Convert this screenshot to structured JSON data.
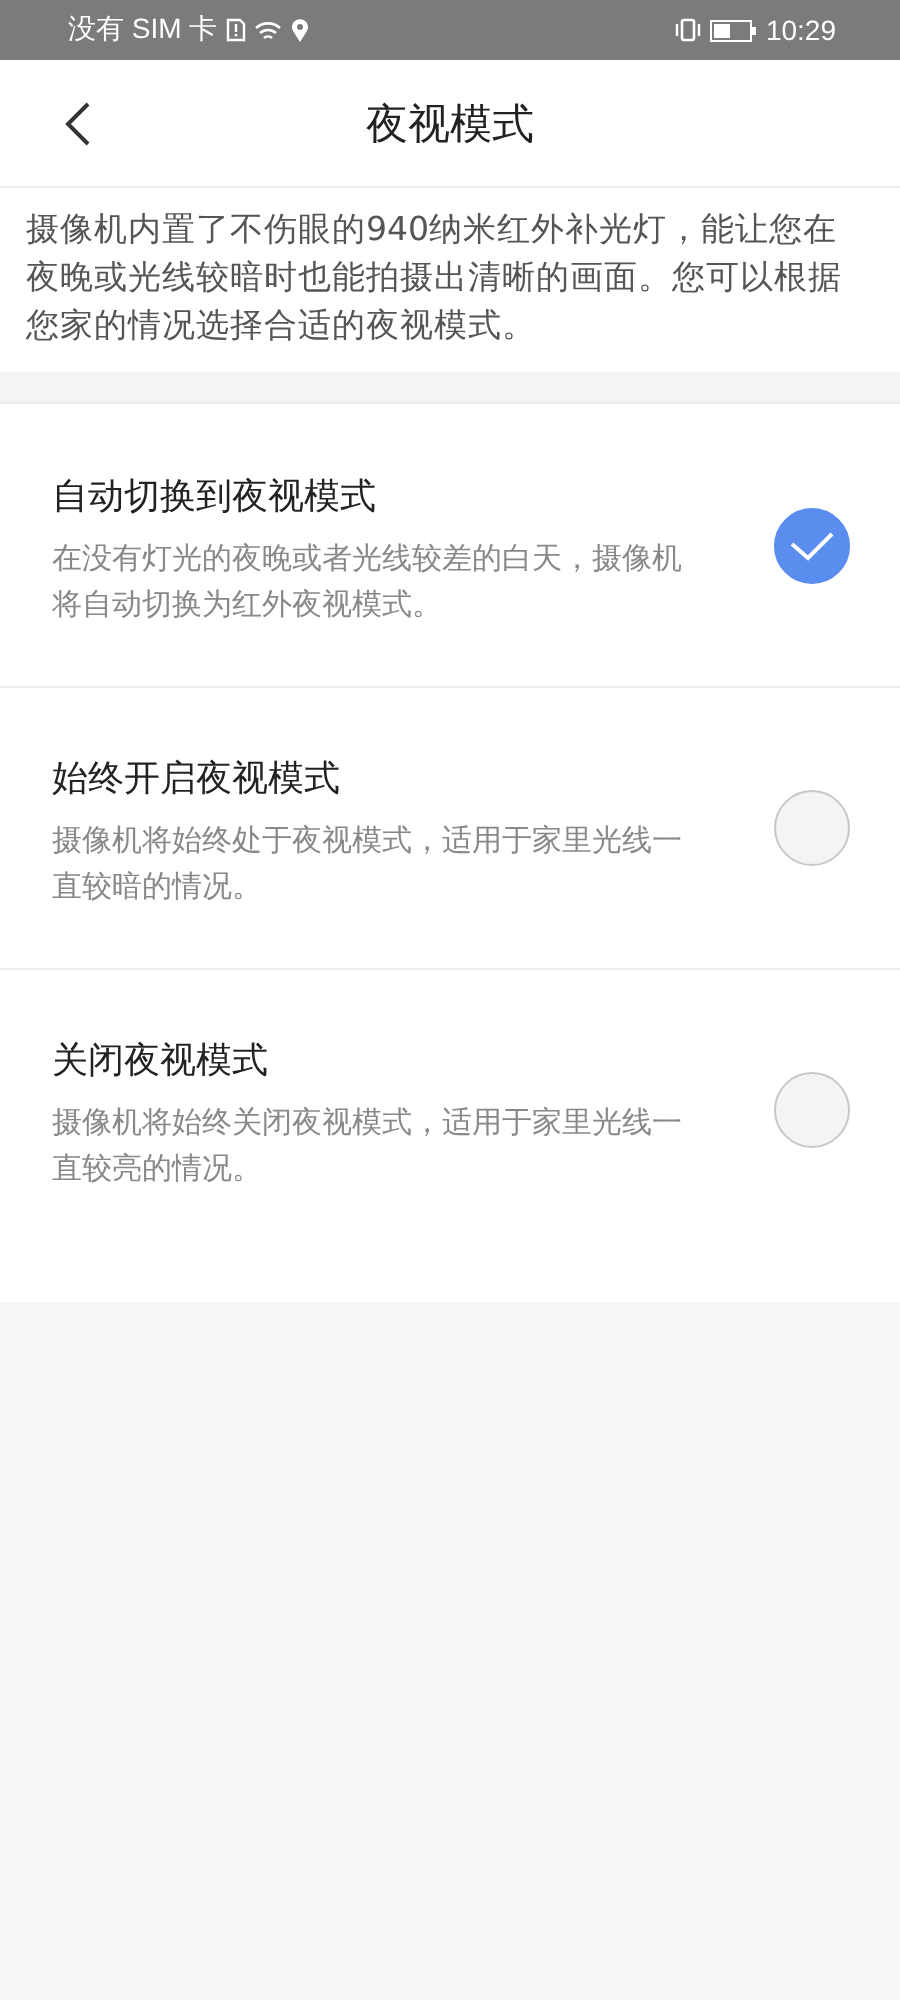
{
  "status_bar": {
    "carrier": "没有 SIM 卡",
    "time": "10:29"
  },
  "header": {
    "title": "夜视模式"
  },
  "intro": "摄像机内置了不伤眼的940纳米红外补光灯，能让您在夜晚或光线较暗时也能拍摄出清晰的画面。您可以根据您家的情况选择合适的夜视模式。",
  "options": [
    {
      "title": "自动切换到夜视模式",
      "description": "在没有灯光的夜晚或者光线较差的白天，摄像机将自动切换为红外夜视模式。",
      "selected": true
    },
    {
      "title": "始终开启夜视模式",
      "description": "摄像机将始终处于夜视模式，适用于家里光线一直较暗的情况。",
      "selected": false
    },
    {
      "title": "关闭夜视模式",
      "description": "摄像机将始终关闭夜视模式，适用于家里光线一直较亮的情况。",
      "selected": false
    }
  ]
}
